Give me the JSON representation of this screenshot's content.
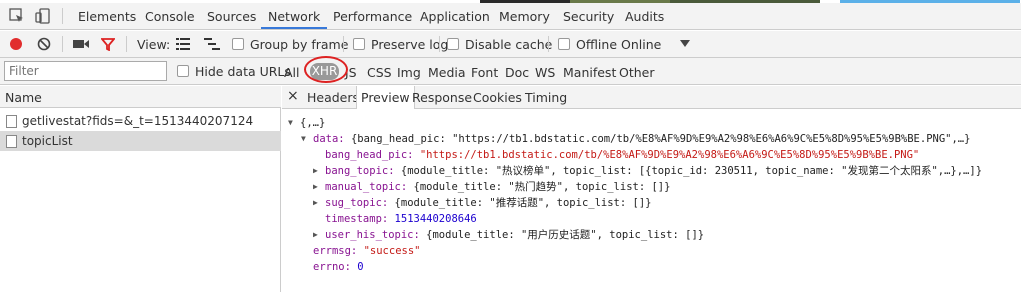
{
  "colors": {
    "accent": "#3879d9",
    "record": "#e12d2d",
    "filter_icon": "#d22",
    "xhr_highlight_circle": "#d22"
  },
  "main_tabs": [
    "Elements",
    "Console",
    "Sources",
    "Network",
    "Performance",
    "Application",
    "Memory",
    "Security",
    "Audits"
  ],
  "active_main_tab": "Network",
  "toolbar": {
    "view_label": "View:",
    "group_by_frame": "Group by frame",
    "preserve_log": "Preserve log",
    "disable_cache": "Disable cache",
    "offline": "Offline",
    "throttle": "Online"
  },
  "filter": {
    "placeholder": "Filter",
    "hide_data_urls": "Hide data URLs",
    "types": [
      "All",
      "XHR",
      "JS",
      "CSS",
      "Img",
      "Media",
      "Font",
      "Doc",
      "WS",
      "Manifest",
      "Other"
    ],
    "active_type": "XHR"
  },
  "requests": {
    "header": "Name",
    "rows": [
      {
        "name": "getlivestat?fids=&_t=1513440207124",
        "selected": false
      },
      {
        "name": "topicList",
        "selected": true
      }
    ]
  },
  "detail_tabs": [
    "Headers",
    "Preview",
    "Response",
    "Cookies",
    "Timing"
  ],
  "active_detail_tab": "Preview",
  "preview": {
    "root": "{,…}",
    "data_key": "data:",
    "data_summary": "{bang_head_pic: \"https://tb1.bdstatic.com/tb/%E8%AF%9D%E9%A2%98%E6%A6%9C%E5%8D%95%E5%9B%BE.PNG\",…}",
    "bang_head_pic_key": "bang_head_pic:",
    "bang_head_pic_val": "\"https://tb1.bdstatic.com/tb/%E8%AF%9D%E9%A2%98%E6%A6%9C%E5%8D%95%E5%9B%BE.PNG\"",
    "bang_topic_key": "bang_topic:",
    "bang_topic_val": "{module_title: \"热议榜单\", topic_list: [{topic_id: 230511, topic_name: \"发现第二个太阳系\",…},…]}",
    "manual_topic_key": "manual_topic:",
    "manual_topic_val": "{module_title: \"热门趋势\", topic_list: []}",
    "sug_topic_key": "sug_topic:",
    "sug_topic_val": "{module_title: \"推荐话题\", topic_list: []}",
    "timestamp_key": "timestamp:",
    "timestamp_val": "1513440208646",
    "user_his_topic_key": "user_his_topic:",
    "user_his_topic_val": "{module_title: \"用户历史话题\", topic_list: []}",
    "errmsg_key": "errmsg:",
    "errmsg_val": "\"success\"",
    "errno_key": "errno:",
    "errno_val": "0"
  }
}
